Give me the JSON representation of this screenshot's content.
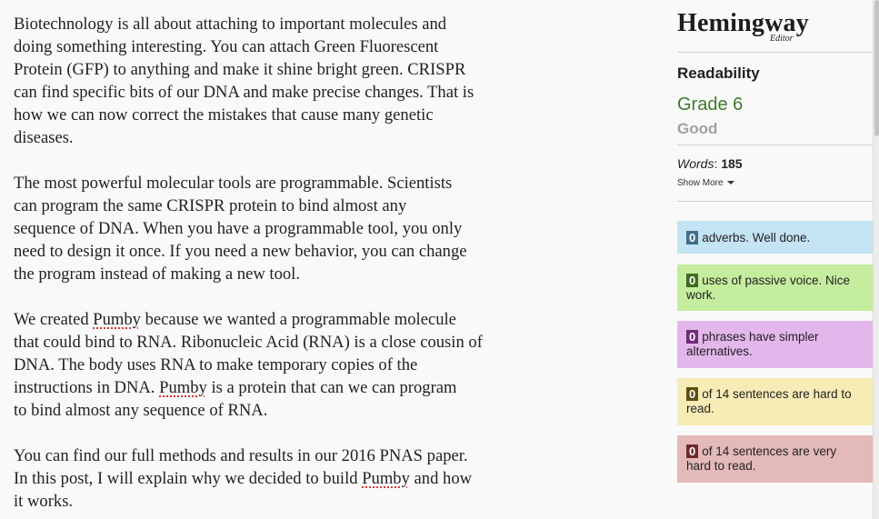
{
  "editor": {
    "paragraphs": [
      {
        "lines": [
          "Biotechnology is all about attaching to important molecules and",
          "doing something interesting. You can attach Green Fluorescent",
          "Protein (GFP) to anything and make it shine bright green. CRISPR",
          "can find specific bits of our DNA and make precise changes. That is",
          "how we can now correct the mistakes that cause many genetic",
          "diseases."
        ]
      },
      {
        "lines": [
          "The most powerful molecular tools are programmable. Scientists",
          "can program the same CRISPR protein to bind almost any",
          "sequence of DNA. When you have a programmable tool, you only",
          "need to design it once. If you need a new behavior, you can change",
          "the program instead of making a new tool."
        ]
      },
      {
        "lines": [
          "We created ",
          "Pumby",
          " because we wanted a programmable molecule",
          "that could bind to RNA. Ribonucleic Acid (RNA) is a close cousin of",
          "DNA. The body uses RNA to make temporary copies of the",
          "instructions in DNA. ",
          "Pumby",
          " is a protein that can we can program",
          "to bind almost any sequence of RNA."
        ]
      },
      {
        "lines": [
          "You can find our full methods and results in our 2016 PNAS paper.",
          "In this post, I will explain why we decided to build ",
          "Pumby",
          " and how",
          "it works."
        ]
      }
    ]
  },
  "sidebar": {
    "logo_main": "Hemingway",
    "logo_sub": "Editor",
    "readability_label": "Readability",
    "grade": "Grade 6",
    "grade_quality": "Good",
    "words_label": "Words",
    "words_colon": ":",
    "words_count": "185",
    "show_more": "Show More",
    "stats": [
      {
        "count": "0",
        "text": "adverbs. Well done.",
        "bg": "#c4e3f3",
        "badge": "#3f6f8a"
      },
      {
        "count": "0",
        "text": "uses of passive voice. Nice work.",
        "bg": "#c4ed9d",
        "badge": "#3d6b1f"
      },
      {
        "count": "0",
        "text": "phrases have simpler alternatives.",
        "bg": "#e3b7eb",
        "badge": "#6d2b78"
      },
      {
        "count": "0",
        "text": "of 14 sentences are hard to read.",
        "bg": "#f7ecb5",
        "badge": "#5c5010"
      },
      {
        "count": "0",
        "text": "of 14 sentences are very hard to read.",
        "bg": "#e4b9b9",
        "badge": "#6e2b2b"
      }
    ]
  }
}
